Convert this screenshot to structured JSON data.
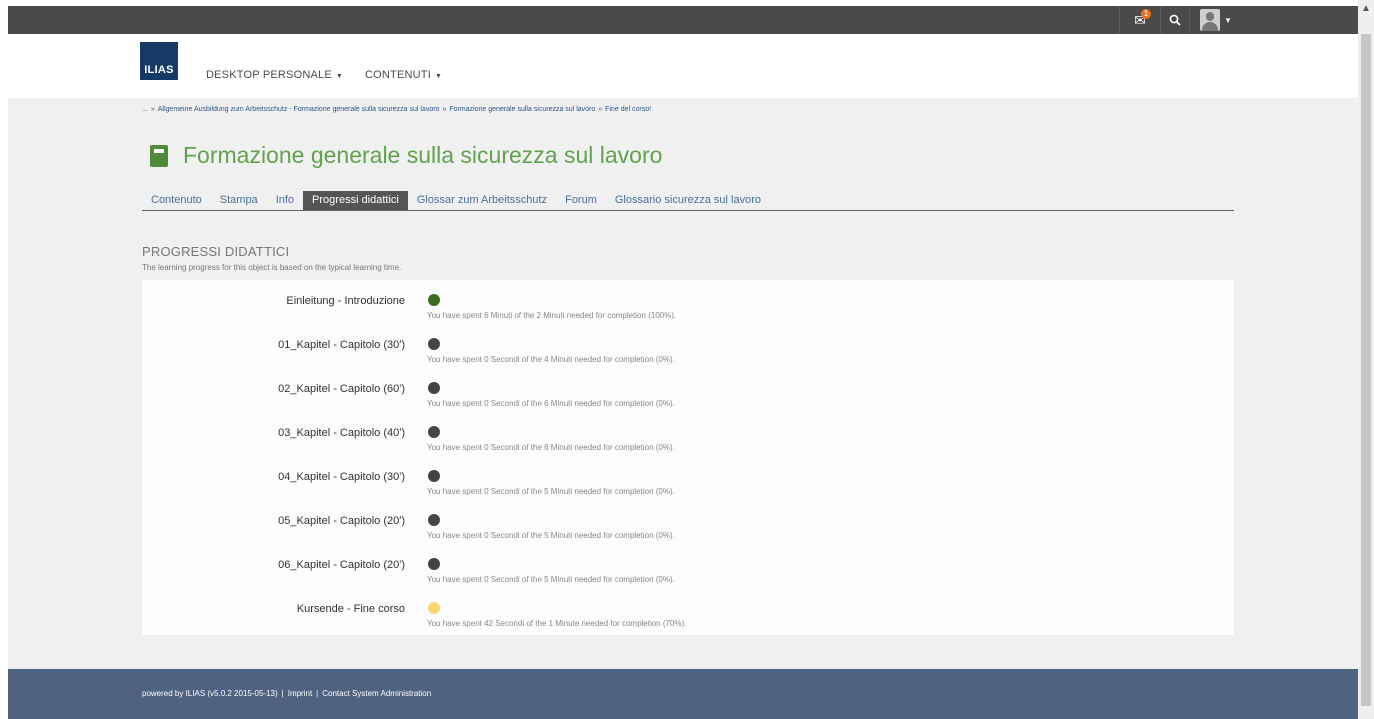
{
  "topbar": {
    "mail_icon": "envelope-icon",
    "mail_badge": "1",
    "search_icon": "search-icon",
    "user_icon": "user-avatar-icon"
  },
  "header": {
    "logo_text": "ILIAS",
    "nav": [
      {
        "label": "DESKTOP PERSONALE"
      },
      {
        "label": "CONTENUTI"
      }
    ]
  },
  "breadcrumb": {
    "ellipsis": "...",
    "items": [
      "Allgemeine Ausbildung zum Arbeitsschutz - Formazione generale sulla sicurezza sul lavoro",
      "Formazione generale sulla sicurezza sul lavoro",
      "Fine del corso!"
    ]
  },
  "page": {
    "title": "Formazione generale sulla sicurezza sul lavoro"
  },
  "tabs": [
    {
      "label": "Contenuto",
      "active": false
    },
    {
      "label": "Stampa",
      "active": false
    },
    {
      "label": "Info",
      "active": false
    },
    {
      "label": "Progressi didattici",
      "active": true
    },
    {
      "label": "Glossar zum Arbeitsschutz",
      "active": false
    },
    {
      "label": "Forum",
      "active": false
    },
    {
      "label": "Glossario sicurezza sul lavoro",
      "active": false
    }
  ],
  "progress": {
    "heading": "PROGRESSI DIDATTICI",
    "subheading": "The learning progress for this object is based on the typical learning time.",
    "rows": [
      {
        "label": "Einleitung - Introduzione",
        "status_color": "#3d6b22",
        "text": "You have spent 6 Minuti of the 2 Minuti needed for completion (100%)."
      },
      {
        "label": "01_Kapitel - Capitolo (30')",
        "status_color": "#444444",
        "text": "You have spent 0 Secondi of the 4 Minuti needed for completion (0%)."
      },
      {
        "label": "02_Kapitel - Capitolo (60')",
        "status_color": "#444444",
        "text": "You have spent 0 Secondi of the 6 Minuti needed for completion (0%)."
      },
      {
        "label": "03_Kapitel - Capitolo (40')",
        "status_color": "#444444",
        "text": "You have spent 0 Secondi of the 6 Minuti needed for completion (0%)."
      },
      {
        "label": "04_Kapitel - Capitolo (30')",
        "status_color": "#444444",
        "text": "You have spent 0 Secondi of the 5 Minuti needed for completion (0%)."
      },
      {
        "label": "05_Kapitel - Capitolo (20')",
        "status_color": "#444444",
        "text": "You have spent 0 Secondi of the 5 Minuti needed for completion (0%)."
      },
      {
        "label": "06_Kapitel - Capitolo (20')",
        "status_color": "#444444",
        "text": "You have spent 0 Secondi of the 5 Minuti needed for completion (0%)."
      },
      {
        "label": "Kursende - Fine corso",
        "status_color": "#f5d76e",
        "text": "You have spent 42 Secondi of the 1 Minute needed for completion (70%)."
      }
    ]
  },
  "footer": {
    "powered": "powered by ILIAS (v5.0.2 2015-05-13)",
    "separator": "|",
    "imprint": "Imprint",
    "contact": "Contact System Administration"
  }
}
